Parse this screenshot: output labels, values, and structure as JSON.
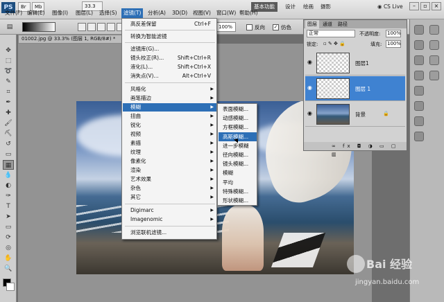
{
  "app": {
    "logo": "PS",
    "workspace_buttons": [
      "基本功能",
      "设计",
      "绘画",
      "摄影"
    ],
    "cs_live": "CS Live",
    "zoom_mini": "33.3"
  },
  "menubar": {
    "items": [
      "文件(F)",
      "编辑(E)",
      "图像(I)",
      "图层(L)",
      "选择(S)",
      "滤镜(T)",
      "分析(A)",
      "3D(D)",
      "视图(V)",
      "窗口(W)",
      "帮助(H)"
    ]
  },
  "options": {
    "zoom_value": "100%",
    "reverse_label": "反向",
    "dither_label": "仿色"
  },
  "document": {
    "tab_title": "01002.jpg @ 33.3% (图层 1, RGB/8#) *"
  },
  "filter_menu": {
    "last_filter": "高反差保留",
    "last_filter_shortcut": "Ctrl+F",
    "convert_smart": "转换为智能滤镜",
    "gallery": "滤镜库(G)...",
    "lens_correction": "镜头校正(R)...",
    "lens_correction_shortcut": "Shift+Ctrl+R",
    "liquify": "液化(L)...",
    "liquify_shortcut": "Shift+Ctrl+X",
    "vanishing_point": "消失点(V)...",
    "vanishing_point_shortcut": "Alt+Ctrl+V",
    "categories": [
      "风格化",
      "画笔描边",
      "模糊",
      "扭曲",
      "锐化",
      "视频",
      "素描",
      "纹理",
      "像素化",
      "渲染",
      "艺术效果",
      "杂色",
      "其它"
    ],
    "plugins": [
      "Digimarc",
      "Imagenomic"
    ],
    "browse_online": "浏览联机滤镜..."
  },
  "blur_submenu": {
    "items": [
      "表面模糊...",
      "动感模糊...",
      "方框模糊...",
      "高斯模糊...",
      "进一步模糊",
      "径向模糊...",
      "镜头模糊...",
      "模糊",
      "平均",
      "特殊模糊...",
      "形状模糊..."
    ],
    "highlighted": "高斯模糊..."
  },
  "layers_panel": {
    "tabs": [
      "图层",
      "通道",
      "路径"
    ],
    "blend_mode": "正常",
    "opacity_label": "不透明度:",
    "opacity_value": "100%",
    "lock_label": "锁定:",
    "fill_label": "填充:",
    "fill_value": "100%",
    "layers": [
      {
        "name": "图层1",
        "selected": false
      },
      {
        "name": "图层 1",
        "selected": true
      },
      {
        "name": "背景",
        "selected": false
      }
    ],
    "footer_icons": "∞ fx ◘ ◑ ▭ ▢ ▥"
  },
  "watermark": {
    "brand": "Bai 经验",
    "url": "jingyan.baidu.com"
  },
  "colors": {
    "highlight": "#2d6fb6",
    "selected_layer": "#3f82d1"
  }
}
